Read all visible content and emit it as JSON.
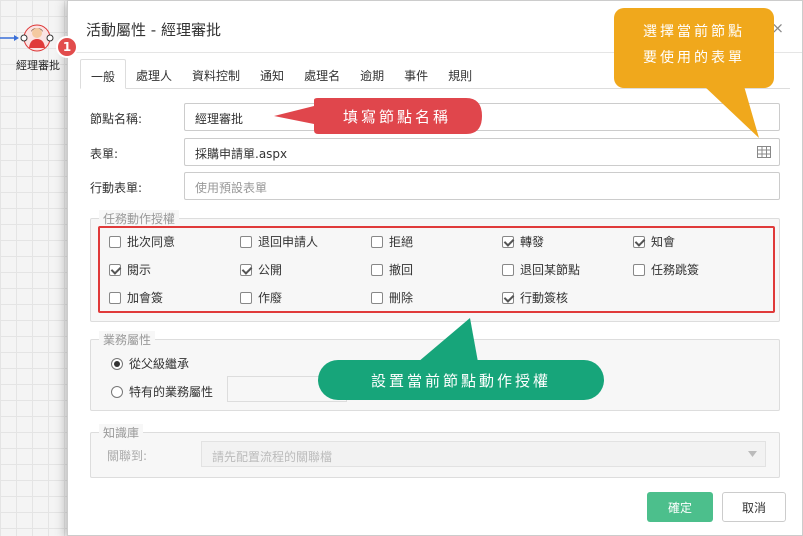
{
  "canvas_node": {
    "label": "經理審批"
  },
  "dialog": {
    "title": "活動屬性 - 經理審批",
    "close": "×",
    "tabs": [
      "一般",
      "處理人",
      "資料控制",
      "通知",
      "處理名",
      "逾期",
      "事件",
      "規則"
    ],
    "fields": {
      "node_name": {
        "label": "節點名稱:",
        "value": "經理審批"
      },
      "form": {
        "label": "表單:",
        "value": "採購申請單.aspx"
      },
      "mobile_form": {
        "label": "行動表單:",
        "placeholder": "使用預設表單"
      }
    },
    "task_permissions": {
      "legend": "任務動作授權",
      "items": [
        {
          "label": "批次同意",
          "checked": false
        },
        {
          "label": "退回申請人",
          "checked": false
        },
        {
          "label": "拒絕",
          "checked": false
        },
        {
          "label": "轉發",
          "checked": true
        },
        {
          "label": "知會",
          "checked": true
        },
        {
          "label": "閱示",
          "checked": true
        },
        {
          "label": "公開",
          "checked": true
        },
        {
          "label": "撤回",
          "checked": false
        },
        {
          "label": "退回某節點",
          "checked": false
        },
        {
          "label": "任務跳簽",
          "checked": false
        },
        {
          "label": "加會簽",
          "checked": false
        },
        {
          "label": "作廢",
          "checked": false
        },
        {
          "label": "刪除",
          "checked": false
        },
        {
          "label": "行動簽核",
          "checked": true
        }
      ]
    },
    "business": {
      "legend": "業務屬性",
      "options": [
        {
          "label": "從父級繼承",
          "selected": true
        },
        {
          "label": "特有的業務屬性",
          "selected": false
        }
      ]
    },
    "knowledge": {
      "legend": "知識庫",
      "link_label": "關聯到:",
      "link_placeholder": "請先配置流程的關聯檔"
    },
    "buttons": {
      "ok": "確定",
      "cancel": "取消"
    }
  },
  "annotations": {
    "badge": "1",
    "fill_name": "填寫節點名稱",
    "choose_form_line1": "選擇當前節點",
    "choose_form_line2": "要使用的表單",
    "set_permissions": "設置當前節點動作授權"
  },
  "colors": {
    "callout_red": "#e0464c",
    "callout_orange": "#f0a81c",
    "callout_green": "#17a57a",
    "ok_button": "#4cbf8c"
  }
}
